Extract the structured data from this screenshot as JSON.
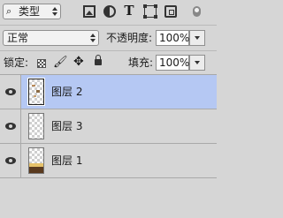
{
  "filter": {
    "search_glyph": "⌕",
    "kind_label": "类型",
    "icons": [
      "image-filter-icon",
      "adjustment-filter-icon",
      "type-filter-icon",
      "shape-filter-icon",
      "smart-object-filter-icon"
    ],
    "type_glyph": "T"
  },
  "blend": {
    "mode_label": "正常",
    "opacity_label": "不透明度:",
    "opacity_value": "100%"
  },
  "lock": {
    "label": "锁定:",
    "move_glyph": "✥",
    "brush_glyph": "🖌",
    "fill_label": "填充:",
    "fill_value": "100%"
  },
  "layers": [
    {
      "name": "图层 2",
      "selected": true,
      "visible": true
    },
    {
      "name": "图层 3",
      "selected": false,
      "visible": true
    },
    {
      "name": "图层 1",
      "selected": false,
      "visible": true
    }
  ],
  "colors": {
    "selected_row": "#b5c8f3",
    "panel_bg": "#d6d6d6",
    "layer1_band_dark": "#5a3a1e",
    "layer1_band_gold": "#e6c26a"
  }
}
